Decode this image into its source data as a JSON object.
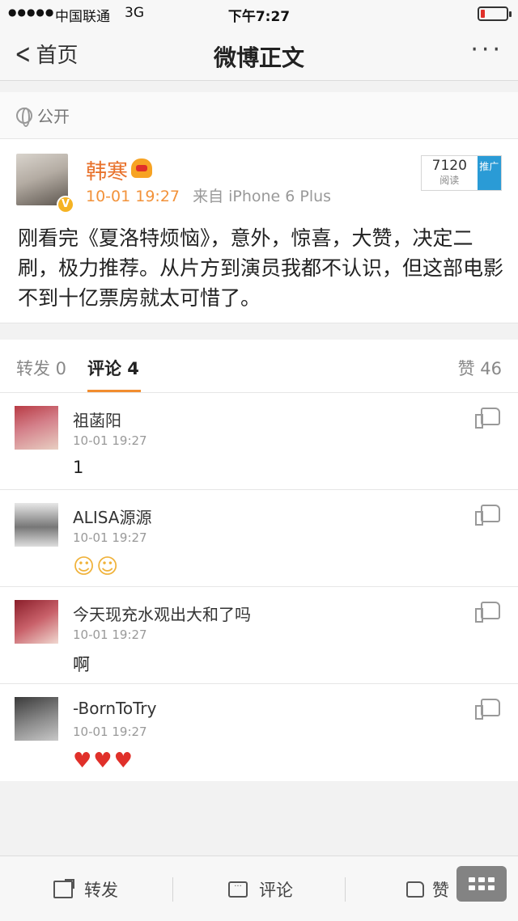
{
  "status_bar": {
    "carrier": "中国联通",
    "network": "3G",
    "time": "下午7:27"
  },
  "nav": {
    "back_label": "首页",
    "title": "微博正文",
    "more": "···"
  },
  "visibility": {
    "label": "公开"
  },
  "post": {
    "author": "韩寒",
    "verified_badge": "V",
    "timestamp": "10-01 19:27",
    "source": "来自 iPhone 6 Plus",
    "read_count": "7120",
    "read_label": "阅读",
    "promote_label": "推广",
    "content": "刚看完《夏洛特烦恼》，意外，惊喜，大赞，决定二刷，极力推荐。从片方到演员我都不认识，但这部电影不到十亿票房就太可惜了。"
  },
  "tabs": {
    "repost": "转发 0",
    "comment": "评论 4",
    "like": "赞 46"
  },
  "comments": [
    {
      "name": "祖菡阳",
      "time": "10-01 19:27",
      "text": "1",
      "kind": "text"
    },
    {
      "name": "ALISA源源",
      "time": "10-01 19:27",
      "text": "☺☺",
      "kind": "smile"
    },
    {
      "name": "今天现充水观出大和了吗",
      "time": "10-01 19:27",
      "text": "啊",
      "kind": "text"
    },
    {
      "name": "-BornToTry",
      "time": "10-01 19:27",
      "text": "♥♥♥",
      "kind": "heart"
    }
  ],
  "bottom_bar": {
    "repost": "转发",
    "comment": "评论",
    "like": "赞"
  },
  "colors": {
    "accent_orange": "#f28d2f",
    "author_orange": "#e8722c",
    "promo_blue": "#2a9bd6"
  }
}
